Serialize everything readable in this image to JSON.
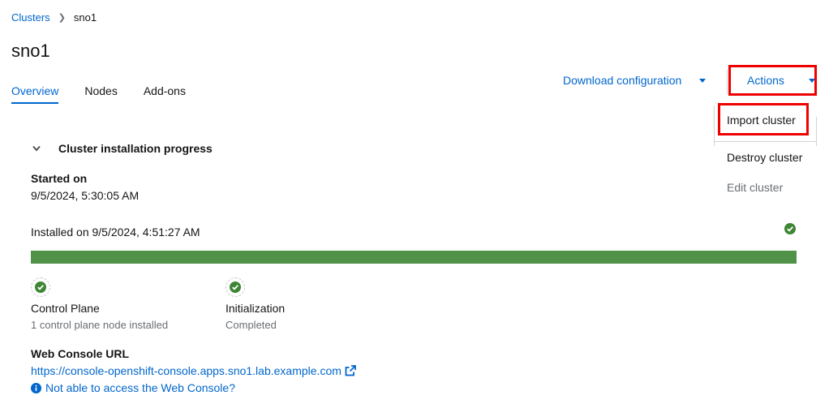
{
  "breadcrumb": {
    "parent": "Clusters",
    "current": "sno1"
  },
  "page_title": "sno1",
  "tabs": [
    {
      "label": "Overview",
      "active": true
    },
    {
      "label": "Nodes"
    },
    {
      "label": "Add-ons"
    }
  ],
  "toolbar": {
    "download_label": "Download configuration",
    "actions_label": "Actions"
  },
  "actions_menu": {
    "items": [
      {
        "label": "Import cluster"
      },
      {
        "label": "Destroy cluster"
      },
      {
        "label": "Edit cluster",
        "disabled": true
      }
    ]
  },
  "progress_section": {
    "title": "Cluster installation progress",
    "started_label": "Started on",
    "started_value": "9/5/2024, 5:30:05 AM",
    "installed_text": "Installed on 9/5/2024, 4:51:27 AM",
    "progress_percent": 100,
    "steps": [
      {
        "title": "Control Plane",
        "detail": "1 control plane node installed"
      },
      {
        "title": "Initialization",
        "detail": "Completed"
      }
    ]
  },
  "web_console": {
    "label": "Web Console URL",
    "url": "https://console-openshift-console.apps.sno1.lab.example.com",
    "help_link": "Not able to access the Web Console?"
  },
  "colors": {
    "link": "#0066cc",
    "success": "#3e8635",
    "highlight": "#ee0000"
  },
  "icons": [
    "chevron-right-icon",
    "caret-down-icon",
    "check-circle-icon",
    "external-link-icon",
    "info-circle-icon"
  ]
}
